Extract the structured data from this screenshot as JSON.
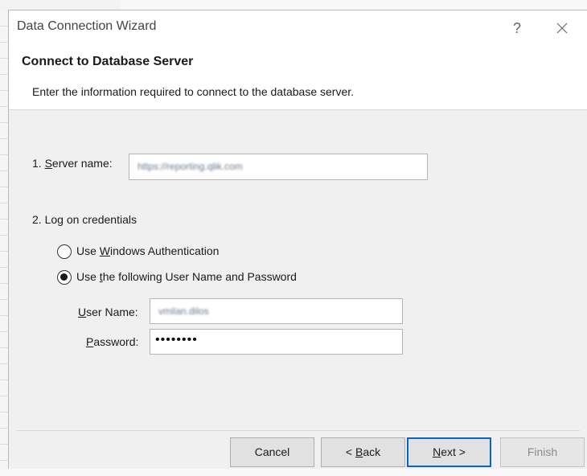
{
  "dialog": {
    "title": "Data Connection Wizard",
    "help_label": "?",
    "header_title": "Connect to Database Server",
    "header_subtitle": "Enter the information required to connect to the database server."
  },
  "server": {
    "label_prefix": "1. ",
    "label_accel": "S",
    "label_rest": "erver name:",
    "value": "https://reporting.qlik.com"
  },
  "credentials": {
    "section_label": "2. Log on credentials",
    "windows_auth": {
      "prefix": "Use ",
      "accel": "W",
      "rest": "indows Authentication",
      "selected": false
    },
    "user_pass": {
      "prefix": "Use ",
      "accel": "t",
      "rest": "he following User Name and Password",
      "selected": true
    },
    "username_label_accel": "U",
    "username_label_rest": "ser Name:",
    "username_value": "vmilan.dilos",
    "password_label_accel": "P",
    "password_label_rest": "assword:",
    "password_value": "••••••••"
  },
  "buttons": {
    "cancel": {
      "label": "Cancel"
    },
    "back": {
      "prefix": "< ",
      "accel": "B",
      "rest": "ack"
    },
    "next": {
      "accel": "N",
      "rest": "ext >"
    },
    "finish": {
      "label": "Finish",
      "enabled": false
    }
  }
}
